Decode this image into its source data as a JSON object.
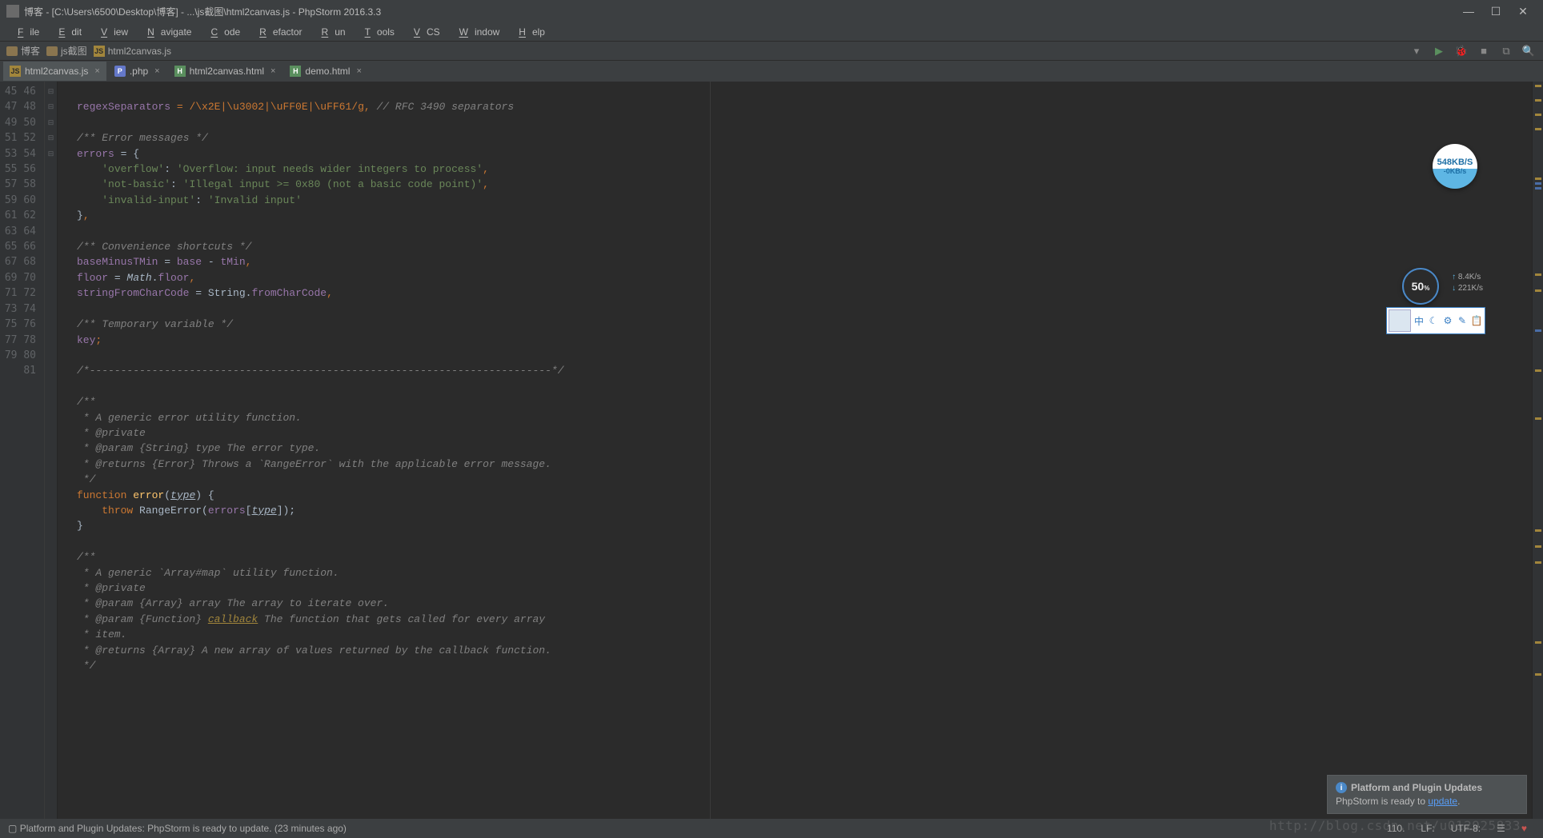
{
  "title": "博客 - [C:\\Users\\6500\\Desktop\\博客] - ...\\js截图\\html2canvas.js - PhpStorm 2016.3.3",
  "menu": [
    "File",
    "Edit",
    "View",
    "Navigate",
    "Code",
    "Refactor",
    "Run",
    "Tools",
    "VCS",
    "Window",
    "Help"
  ],
  "crumbs": [
    {
      "icon": "folder",
      "label": "博客"
    },
    {
      "icon": "folder",
      "label": "js截图"
    },
    {
      "icon": "js",
      "label": "html2canvas.js"
    }
  ],
  "tabs": [
    {
      "icon": "js",
      "label": "html2canvas.js",
      "active": true
    },
    {
      "icon": "php",
      "label": ".php",
      "active": false
    },
    {
      "icon": "html",
      "label": "html2canvas.html",
      "active": false
    },
    {
      "icon": "html",
      "label": "demo.html",
      "active": false
    }
  ],
  "line_start": 45,
  "line_end": 81,
  "status": {
    "msg": "Platform and Plugin Updates: PhpStorm is ready to update. (23 minutes ago)",
    "pos": "110.",
    "lf": "LF:",
    "enc": "UTF-8:"
  },
  "notif": {
    "title": "Platform and Plugin Updates",
    "body_pre": "PhpStorm is ready to ",
    "body_link": "update",
    "body_post": "."
  },
  "circle1": {
    "main": "548KB/S",
    "sub": "-0KB/s"
  },
  "circle2": {
    "main": "50",
    "sub": "%"
  },
  "speeds": {
    "up": "8.4K/s",
    "down": "221K/s"
  },
  "toolpanel_items": [
    "中",
    "☾",
    "⚙",
    "✎",
    "📋"
  ],
  "watermark": "http://blog.csdn.net/u012925833",
  "code": {
    "l45_a": "regexSeparators",
    "l45_eq": " = ",
    "l45_rx": "/\\x2E|\\u3002|\\uFF0E|\\uFF61/g",
    "l45_c": ",",
    "l45_com": " // RFC 3490 separators",
    "l47": "/** Error messages */",
    "l48_a": "errors",
    "l48_b": " = {",
    "l49_k": "'overflow'",
    "l49_c": ": ",
    "l49_v": "'Overflow: input needs wider integers to process'",
    "l49_t": ",",
    "l50_k": "'not-basic'",
    "l50_c": ": ",
    "l50_v": "'Illegal input >= 0x80 (not a basic code point)'",
    "l50_t": ",",
    "l51_k": "'invalid-input'",
    "l51_c": ": ",
    "l51_v": "'Invalid input'",
    "l52": "}",
    "l52_t": ",",
    "l54": "/** Convenience shortcuts */",
    "l55_a": "baseMinusTMin",
    "l55_b": " = ",
    "l55_c": "base",
    "l55_d": " - ",
    "l55_e": "tMin",
    "l55_t": ",",
    "l56_a": "floor",
    "l56_b": " = ",
    "l56_c": "Math",
    "l56_d": ".",
    "l56_e": "floor",
    "l56_t": ",",
    "l57_a": "stringFromCharCode",
    "l57_b": " = ",
    "l57_c": "String",
    "l57_d": ".",
    "l57_e": "fromCharCode",
    "l57_t": ",",
    "l59": "/** Temporary variable */",
    "l60_a": "key",
    "l60_t": ";",
    "l62": "/*--------------------------------------------------------------------------*/",
    "l64": "/**",
    "l65": " * A generic error utility function.",
    "l66": " * @private",
    "l67": " * @param {String} type The error type.",
    "l68": " * @returns {Error} Throws a `RangeError` with the applicable error message.",
    "l69": " */",
    "l70_a": "function ",
    "l70_b": "error",
    "l70_c": "(",
    "l70_d": "type",
    "l70_e": ") {",
    "l71_a": "throw ",
    "l71_b": "RangeError",
    "l71_c": "(",
    "l71_d": "errors",
    "l71_e": "[",
    "l71_f": "type",
    "l71_g": "]);",
    "l72": "}",
    "l74": "/**",
    "l75": " * A generic `Array#map` utility function.",
    "l76": " * @private",
    "l77": " * @param {Array} array The array to iterate over.",
    "l78_a": " * @param {Function} ",
    "l78_b": "callback",
    "l78_c": " The function that gets called for every array",
    "l79": " * item.",
    "l80": " * @returns {Array} A new array of values returned by the callback function.",
    "l81": " */"
  }
}
